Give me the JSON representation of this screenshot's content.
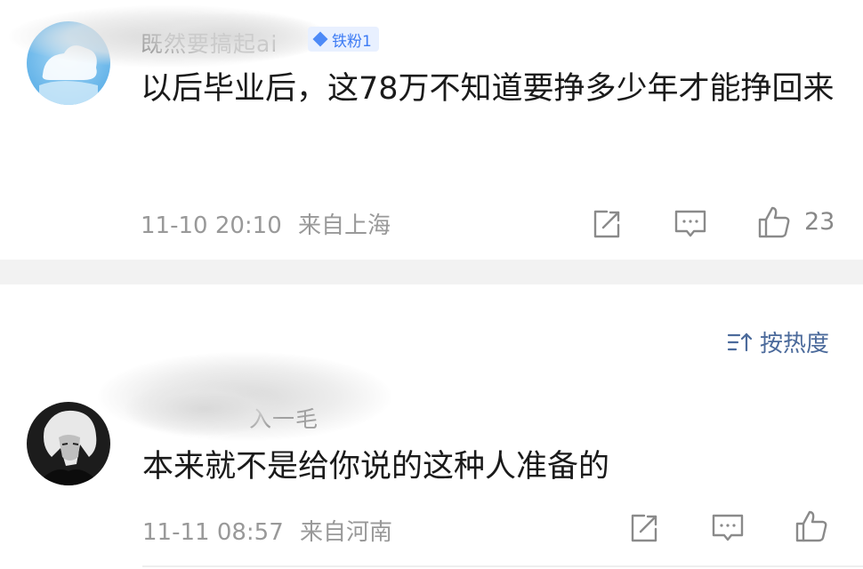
{
  "comments": [
    {
      "username": "既然要搞起ai",
      "badge": "铁粉1",
      "text": "以后毕业后，这78万不知道要挣多少年才能挣回来",
      "time": "11-10 20:10",
      "location": "来自上海",
      "likes": "23"
    },
    {
      "username": "入一毛",
      "text": "本来就不是给你说的这种人准备的",
      "time": "11-11 08:57",
      "location": "来自河南",
      "likes": ""
    }
  ],
  "sort": {
    "label": "按热度"
  },
  "icons": {
    "share": "share-icon",
    "reply": "comment-icon",
    "like": "thumbs-up-icon",
    "sort": "sort-icon"
  },
  "colors": {
    "badge_bg": "#e8f0ff",
    "badge_text": "#3d7bf4",
    "sort_text": "#4b6a9b",
    "meta_text": "#999999",
    "divider": "#f2f2f2"
  }
}
